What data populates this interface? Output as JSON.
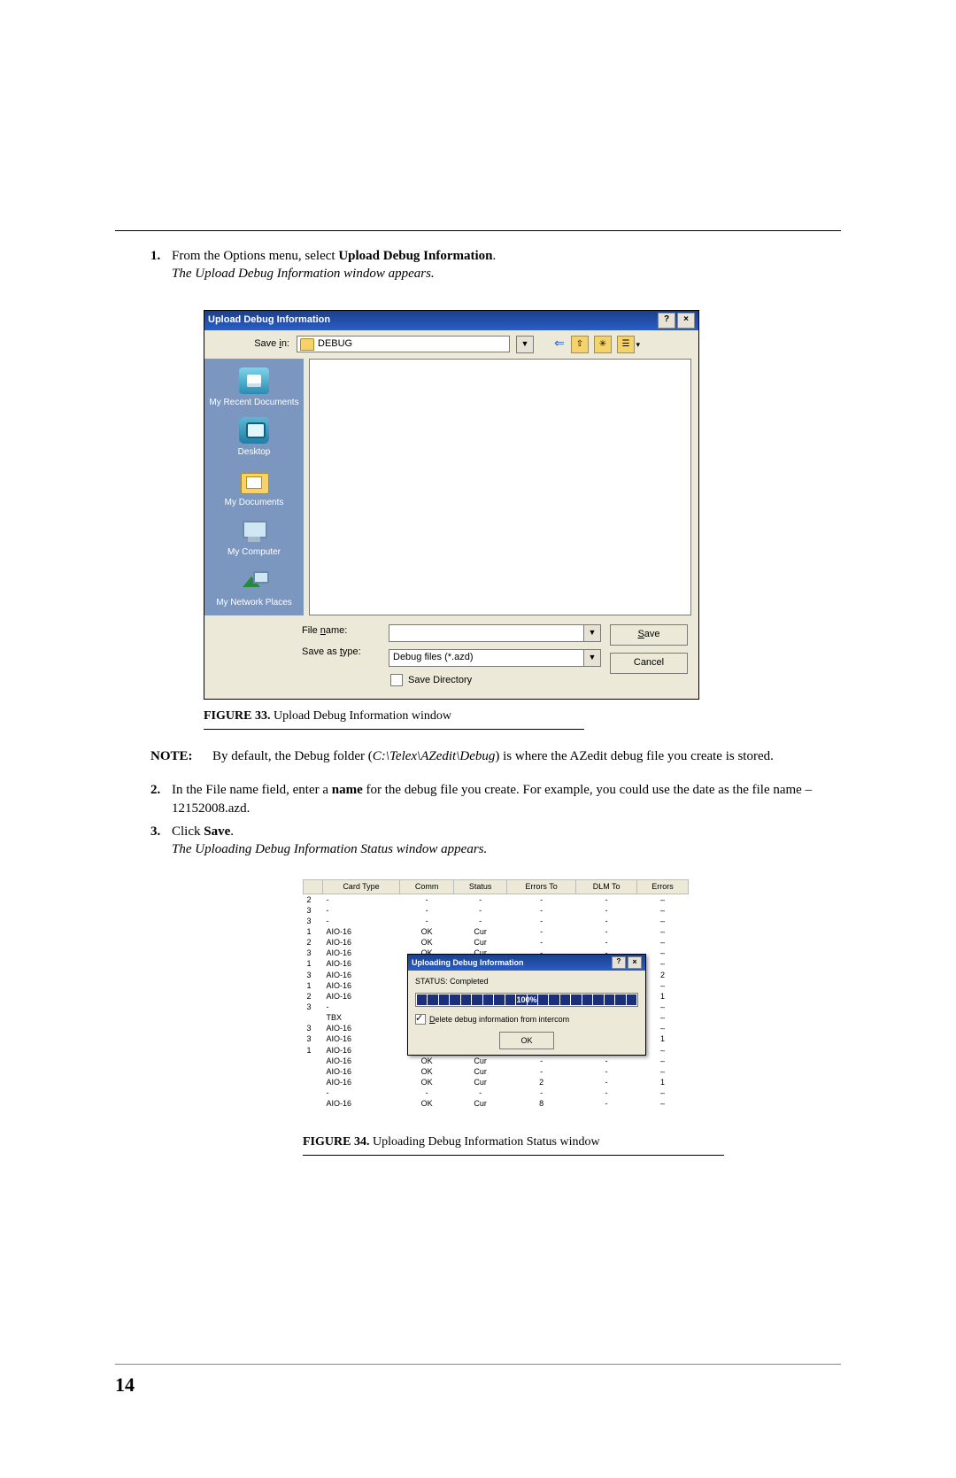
{
  "steps": {
    "s1": {
      "num": "1.",
      "prefix": "From the Options menu, select ",
      "bold": "Upload Debug Information",
      "suffix": ".",
      "result": "The Upload Debug Information window appears."
    },
    "s2": {
      "num": "2.",
      "prefix": "In the File name field, enter a ",
      "bold": "name",
      "suffix": " for the debug file you create. For example, you could use the date as the file name – 12152008.azd."
    },
    "s3": {
      "num": "3.",
      "prefix": "Click ",
      "bold": "Save",
      "suffix": ".",
      "result": "The Uploading Debug Information Status window appears."
    }
  },
  "dialog": {
    "title": "Upload Debug Information",
    "help_btn": "?",
    "close_btn": "×",
    "savein_label_pre": "Save ",
    "savein_label_ul": "i",
    "savein_label_post": "n:",
    "savein_value": "DEBUG",
    "places": {
      "recent": "My Recent Documents",
      "desktop": "Desktop",
      "docs": "My Documents",
      "computer": "My Computer",
      "network": "My Network Places"
    },
    "filename_label_pre": "File ",
    "filename_label_ul": "n",
    "filename_label_post": "ame:",
    "filename_value": "",
    "saveas_label_pre": "Save as ",
    "saveas_label_ul": "t",
    "saveas_label_post": "ype:",
    "saveas_value": "Debug files (*.azd)",
    "savedir_label_ul": "S",
    "savedir_label_post": "ave Directory",
    "btn_save_ul": "S",
    "btn_save_post": "ave",
    "btn_cancel": "Cancel"
  },
  "fig1": {
    "label": "FIGURE 33.",
    "caption": " Upload Debug Information window"
  },
  "note": {
    "label": "NOTE:",
    "prefix": "By default, the Debug folder (",
    "italic": "C:\\Telex\\AZedit\\Debug",
    "suffix": ") is where the AZedit debug file you create is stored."
  },
  "status_dialog": {
    "title": "Uploading Debug Information",
    "help_btn": "?",
    "close_btn": "×",
    "status_line": "STATUS: Completed",
    "progress": "100%",
    "delete_ul": "D",
    "delete_post": "elete debug information from intercom",
    "ok": "OK"
  },
  "grid": {
    "headers": [
      "",
      "Card Type",
      "Comm",
      "Status",
      "Errors To",
      "DLM To",
      "Errors"
    ],
    "rows": [
      [
        "2",
        "-",
        "-",
        "-",
        "-",
        "-",
        "–"
      ],
      [
        "3",
        "-",
        "-",
        "-",
        "-",
        "-",
        "–"
      ],
      [
        "3",
        "-",
        "-",
        "-",
        "-",
        "-",
        "–"
      ],
      [
        "1",
        "AIO-16",
        "OK",
        "Cur",
        "-",
        "-",
        "–"
      ],
      [
        "2",
        "AIO-16",
        "OK",
        "Cur",
        "-",
        "-",
        "–"
      ],
      [
        "3",
        "AIO-16",
        "OK",
        "Cur",
        "-",
        "-",
        "–"
      ],
      [
        "1",
        "AIO-16",
        "",
        "",
        "",
        "",
        "–"
      ],
      [
        "3",
        "AIO-16",
        "",
        "",
        "",
        "",
        "2"
      ],
      [
        "1",
        "AIO-16",
        "",
        "",
        "",
        "",
        "–"
      ],
      [
        "2",
        "AIO-16",
        "",
        "",
        "",
        "",
        "1"
      ],
      [
        "3",
        "-",
        "",
        "",
        "",
        "",
        "–"
      ],
      [
        "",
        "TBX",
        "",
        "",
        "",
        "",
        "–"
      ],
      [
        "3",
        "AIO-16",
        "",
        "",
        "",
        "",
        "–"
      ],
      [
        "3",
        "AIO-16",
        "",
        "",
        "",
        "",
        "1"
      ],
      [
        "1",
        "AIO-16",
        "",
        "",
        "",
        "",
        "–"
      ],
      [
        "",
        "AIO-16",
        "OK",
        "Cur",
        "-",
        "-",
        "–"
      ],
      [
        "",
        "AIO-16",
        "OK",
        "Cur",
        "-",
        "-",
        "–"
      ],
      [
        "",
        "AIO-16",
        "OK",
        "Cur",
        "2",
        "-",
        "1"
      ],
      [
        "",
        "-",
        "-",
        "-",
        "-",
        "-",
        "–"
      ],
      [
        "",
        "AIO-16",
        "OK",
        "Cur",
        "8",
        "-",
        "–"
      ]
    ]
  },
  "fig2": {
    "label": "FIGURE 34.",
    "caption": " Uploading Debug Information Status window"
  },
  "page_number": "14"
}
